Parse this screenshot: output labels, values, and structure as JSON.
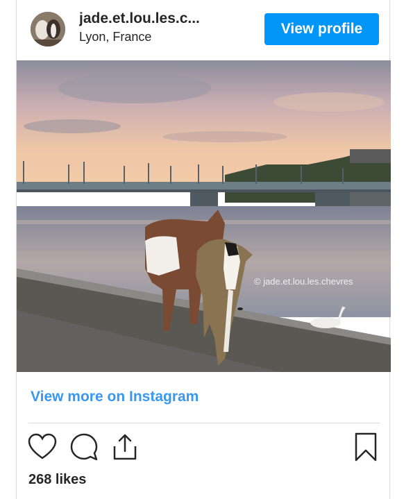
{
  "header": {
    "username": "jade.et.lou.les.c...",
    "location": "Lyon, France",
    "view_profile_label": "View profile"
  },
  "post": {
    "watermark": "© jade.et.lou.les.chevres",
    "view_more_label": "View more on Instagram",
    "likes_text": "268 likes"
  },
  "actions": {
    "icons": [
      "heart-icon",
      "comment-icon",
      "share-icon",
      "bookmark-icon"
    ]
  },
  "colors": {
    "accent": "#0095f6",
    "link": "#3897f0",
    "text": "#262626",
    "divider": "#dbdbdb"
  }
}
